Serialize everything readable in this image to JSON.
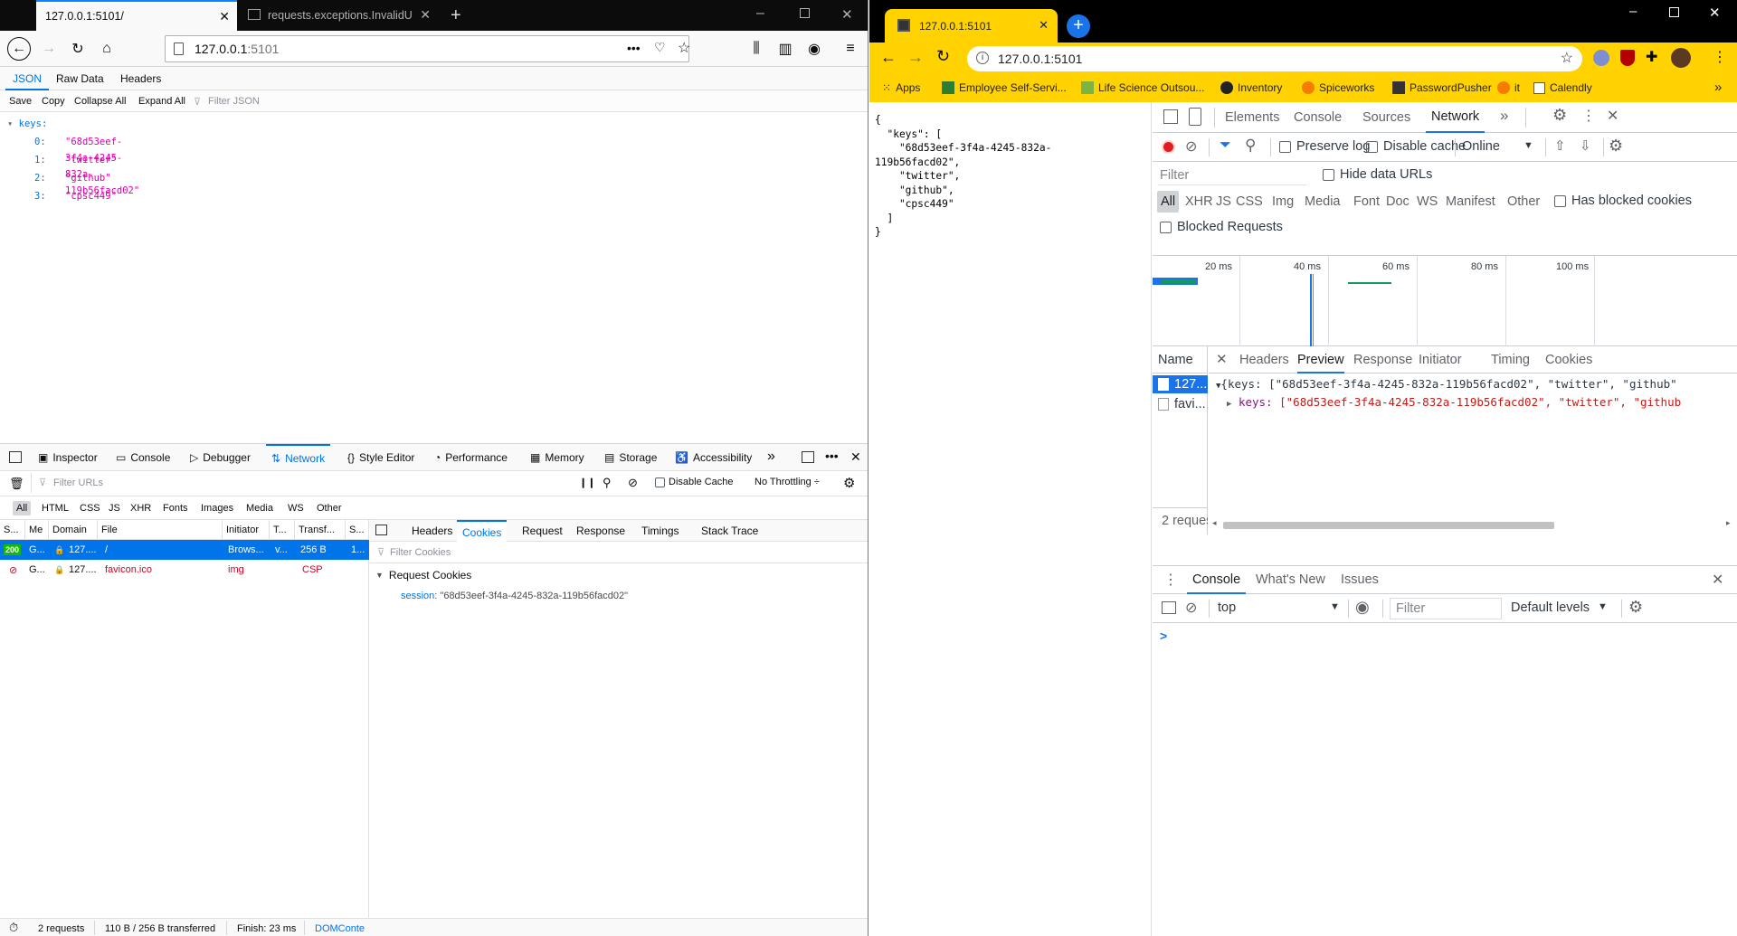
{
  "firefox": {
    "tabs": [
      {
        "title": "127.0.0.1:5101/"
      },
      {
        "title": "requests.exceptions.InvalidURL"
      }
    ],
    "url_host": "127.0.0.1",
    "url_port": ":5101",
    "json_viewer": {
      "tabs": [
        "JSON",
        "Raw Data",
        "Headers"
      ],
      "toolbar": [
        "Save",
        "Copy",
        "Collapse All",
        "Expand All"
      ],
      "filter_placeholder": "Filter JSON",
      "root_key": "keys:",
      "items": [
        {
          "index": "0:",
          "value": "\"68d53eef-3f4a-4245-832a-119b56facd02\""
        },
        {
          "index": "1:",
          "value": "\"twitter\""
        },
        {
          "index": "2:",
          "value": "\"github\""
        },
        {
          "index": "3:",
          "value": "\"cpsc449\""
        }
      ]
    },
    "devtools": {
      "tabs": [
        "Inspector",
        "Console",
        "Debugger",
        "Network",
        "Style Editor",
        "Performance",
        "Memory",
        "Storage",
        "Accessibility"
      ],
      "filter_placeholder": "Filter URLs",
      "disable_cache": "Disable Cache",
      "throttling": "No Throttling ÷",
      "types": [
        "All",
        "HTML",
        "CSS",
        "JS",
        "XHR",
        "Fonts",
        "Images",
        "Media",
        "WS",
        "Other"
      ],
      "columns": [
        "S...",
        "Me",
        "Domain",
        "File",
        "Initiator",
        "T...",
        "Transf...",
        "S..."
      ],
      "requests": [
        {
          "status": "200",
          "method": "G...",
          "domain": "127....",
          "file": "/",
          "initiator": "Brows...",
          "type": "v...",
          "transferred": "256 B",
          "size": "1..."
        },
        {
          "status": "",
          "method": "G...",
          "domain": "127....",
          "file": "favicon.ico",
          "initiator": "img",
          "type": "",
          "transferred": "CSP",
          "size": ""
        }
      ],
      "side_tabs": [
        "Headers",
        "Cookies",
        "Request",
        "Response",
        "Timings",
        "Stack Trace"
      ],
      "filter_cookies": "Filter Cookies",
      "request_cookies": "Request Cookies",
      "cookie_name": "session:",
      "cookie_value": "\"68d53eef-3f4a-4245-832a-119b56facd02\"",
      "status_requests": "2 requests",
      "status_transfer": "110 B / 256 B transferred",
      "status_finish": "Finish: 23 ms",
      "status_domcontent": "DOMConte"
    }
  },
  "chrome": {
    "tab_title": "127.0.0.1:5101",
    "url": "127.0.0.1:5101",
    "bookmarks": [
      "Apps",
      "Employee Self-Servi...",
      "Life Science Outsou...",
      "Inventory",
      "Spiceworks",
      "PasswordPusher",
      "it",
      "Calendly"
    ],
    "page_json": "{\n  \"keys\": [\n    \"68d53eef-3f4a-4245-832a-\n119b56facd02\",\n    \"twitter\",\n    \"github\",\n    \"cpsc449\"\n  ]\n}",
    "devtools": {
      "tabs": [
        "Elements",
        "Console",
        "Sources",
        "Network"
      ],
      "preserve_log": "Preserve log",
      "disable_cache": "Disable cache",
      "throttle": "Online",
      "filter_placeholder": "Filter",
      "hide_data_urls": "Hide data URLs",
      "types": [
        "All",
        "XHR",
        "JS",
        "CSS",
        "Img",
        "Media",
        "Font",
        "Doc",
        "WS",
        "Manifest",
        "Other"
      ],
      "has_blocked_cookies": "Has blocked cookies",
      "blocked_requests": "Blocked Requests",
      "timeline_ticks": [
        "20 ms",
        "40 ms",
        "60 ms",
        "80 ms",
        "100 ms"
      ],
      "name_header": "Name",
      "names": [
        "127...",
        "favi..."
      ],
      "detail_tabs": [
        "Headers",
        "Preview",
        "Response",
        "Initiator",
        "Timing",
        "Cookies"
      ],
      "preview_line1": "{keys: [\"68d53eef-3f4a-4245-832a-119b56facd02\", \"twitter\", \"github\"",
      "preview_line2_key": "keys:",
      "preview_line2_val": "[\"68d53eef-3f4a-4245-832a-119b56facd02\", \"twitter\", \"github",
      "requests_count": "2 reques",
      "drawer_tabs": [
        "Console",
        "What's New",
        "Issues"
      ],
      "context": "top",
      "console_filter": "Filter",
      "levels": "Default levels",
      "prompt": ">"
    }
  }
}
